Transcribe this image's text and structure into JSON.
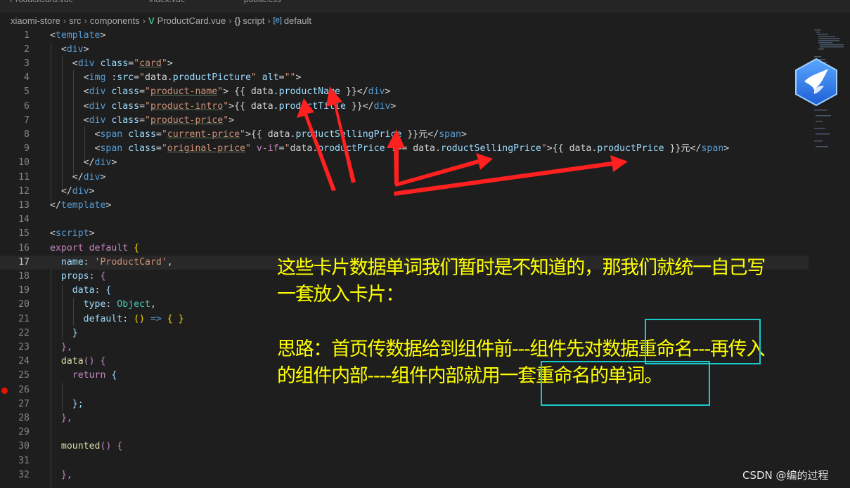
{
  "tabs": [
    "ProductCard.vue",
    "index.vue",
    "public.css"
  ],
  "breadcrumb": {
    "parts": [
      "xiaomi-store",
      "src",
      "components",
      "ProductCard.vue",
      "script",
      "default"
    ],
    "icon_vue": "V",
    "icon_braces": "{}",
    "icon_object": "[e]"
  },
  "active_line": 17,
  "breakpoint_line": 26,
  "code_lines": [
    {
      "n": "1",
      "tokens": [
        [
          "p",
          "<"
        ],
        [
          "t",
          "template"
        ],
        [
          "p",
          ">"
        ]
      ]
    },
    {
      "n": "2",
      "tokens": [
        [
          "p",
          "  <"
        ],
        [
          "t",
          "div"
        ],
        [
          "p",
          ">"
        ]
      ]
    },
    {
      "n": "3",
      "tokens": [
        [
          "p",
          "    <"
        ],
        [
          "t",
          "div"
        ],
        [
          "p",
          " "
        ],
        [
          "a",
          "class"
        ],
        [
          "p",
          "="
        ],
        [
          "s",
          "\""
        ],
        [
          "u",
          "card"
        ],
        [
          "s",
          "\""
        ],
        [
          "p",
          ">"
        ]
      ]
    },
    {
      "n": "4",
      "tokens": [
        [
          "p",
          "      <"
        ],
        [
          "t",
          "img"
        ],
        [
          "p",
          " :"
        ],
        [
          "a",
          "src"
        ],
        [
          "p",
          "="
        ],
        [
          "s",
          "\""
        ],
        [
          "n",
          "data."
        ],
        [
          "a",
          "productPicture"
        ],
        [
          "s",
          "\""
        ],
        [
          "p",
          " "
        ],
        [
          "a",
          "alt"
        ],
        [
          "p",
          "="
        ],
        [
          "s",
          "\"\""
        ],
        [
          "p",
          ">"
        ]
      ]
    },
    {
      "n": "5",
      "tokens": [
        [
          "p",
          "      <"
        ],
        [
          "t",
          "div"
        ],
        [
          "p",
          " "
        ],
        [
          "a",
          "class"
        ],
        [
          "p",
          "="
        ],
        [
          "s",
          "\""
        ],
        [
          "u",
          "product-name"
        ],
        [
          "s",
          "\""
        ],
        [
          "p",
          "> {{ "
        ],
        [
          "n",
          "data."
        ],
        [
          "a",
          "productName"
        ],
        [
          "p",
          " }}</"
        ],
        [
          "t",
          "div"
        ],
        [
          "p",
          ">"
        ]
      ]
    },
    {
      "n": "6",
      "tokens": [
        [
          "p",
          "      <"
        ],
        [
          "t",
          "div"
        ],
        [
          "p",
          " "
        ],
        [
          "a",
          "class"
        ],
        [
          "p",
          "="
        ],
        [
          "s",
          "\""
        ],
        [
          "u",
          "product-intro"
        ],
        [
          "s",
          "\""
        ],
        [
          "p",
          ">{{ "
        ],
        [
          "n",
          "data."
        ],
        [
          "a",
          "productTitle"
        ],
        [
          "p",
          " }}</"
        ],
        [
          "t",
          "div"
        ],
        [
          "p",
          ">"
        ]
      ]
    },
    {
      "n": "7",
      "tokens": [
        [
          "p",
          "      <"
        ],
        [
          "t",
          "div"
        ],
        [
          "p",
          " "
        ],
        [
          "a",
          "class"
        ],
        [
          "p",
          "="
        ],
        [
          "s",
          "\""
        ],
        [
          "u",
          "product-price"
        ],
        [
          "s",
          "\""
        ],
        [
          "p",
          ">"
        ]
      ]
    },
    {
      "n": "8",
      "tokens": [
        [
          "p",
          "        <"
        ],
        [
          "t",
          "span"
        ],
        [
          "p",
          " "
        ],
        [
          "a",
          "class"
        ],
        [
          "p",
          "="
        ],
        [
          "s",
          "\""
        ],
        [
          "u",
          "current-price"
        ],
        [
          "s",
          "\""
        ],
        [
          "p",
          ">{{ "
        ],
        [
          "n",
          "data."
        ],
        [
          "a",
          "productSellingPrice"
        ],
        [
          "p",
          " }}元</"
        ],
        [
          "t",
          "span"
        ],
        [
          "p",
          ">"
        ]
      ]
    },
    {
      "n": "9",
      "tokens": [
        [
          "p",
          "        <"
        ],
        [
          "t",
          "span"
        ],
        [
          "p",
          " "
        ],
        [
          "a",
          "class"
        ],
        [
          "p",
          "="
        ],
        [
          "s",
          "\""
        ],
        [
          "u",
          "original-price"
        ],
        [
          "s",
          "\""
        ],
        [
          "p",
          " "
        ],
        [
          "k",
          "v-if"
        ],
        [
          "p",
          "="
        ],
        [
          "s",
          "\""
        ],
        [
          "n",
          "data."
        ],
        [
          "a",
          "productPrice"
        ],
        [
          "p",
          " !== "
        ],
        [
          "n",
          "data."
        ],
        [
          "a",
          "roductSellingPrice"
        ],
        [
          "s",
          "\""
        ],
        [
          "p",
          ">{{ "
        ],
        [
          "n",
          "data."
        ],
        [
          "a",
          "productPrice"
        ],
        [
          "p",
          " }}元</"
        ],
        [
          "t",
          "span"
        ],
        [
          "p",
          ">"
        ]
      ]
    },
    {
      "n": "10",
      "tokens": [
        [
          "p",
          "      </"
        ],
        [
          "t",
          "div"
        ],
        [
          "p",
          ">"
        ]
      ]
    },
    {
      "n": "11",
      "tokens": [
        [
          "p",
          "    </"
        ],
        [
          "t",
          "div"
        ],
        [
          "p",
          ">"
        ]
      ]
    },
    {
      "n": "12",
      "tokens": [
        [
          "p",
          "  </"
        ],
        [
          "t",
          "div"
        ],
        [
          "p",
          ">"
        ]
      ]
    },
    {
      "n": "13",
      "tokens": [
        [
          "p",
          "</"
        ],
        [
          "t",
          "template"
        ],
        [
          "p",
          ">"
        ]
      ]
    },
    {
      "n": "14",
      "tokens": []
    },
    {
      "n": "15",
      "tokens": [
        [
          "p",
          "<"
        ],
        [
          "t",
          "script"
        ],
        [
          "p",
          ">"
        ]
      ]
    },
    {
      "n": "16",
      "tokens": [
        [
          "k",
          "export"
        ],
        [
          "p",
          " "
        ],
        [
          "k",
          "default"
        ],
        [
          "p",
          " "
        ],
        [
          "y",
          "{"
        ]
      ]
    },
    {
      "n": "17",
      "tokens": [
        [
          "p",
          "  "
        ],
        [
          "a",
          "name"
        ],
        [
          "p",
          ": "
        ],
        [
          "s",
          "'ProductCard'"
        ],
        [
          "p",
          ","
        ]
      ]
    },
    {
      "n": "18",
      "tokens": [
        [
          "p",
          "  "
        ],
        [
          "a",
          "props"
        ],
        [
          "p",
          ": "
        ],
        [
          "k",
          "{"
        ]
      ]
    },
    {
      "n": "19",
      "tokens": [
        [
          "p",
          "    "
        ],
        [
          "a",
          "data"
        ],
        [
          "p",
          ": "
        ],
        [
          "a",
          "{"
        ]
      ]
    },
    {
      "n": "20",
      "tokens": [
        [
          "p",
          "      "
        ],
        [
          "a",
          "type"
        ],
        [
          "p",
          ": "
        ],
        [
          "g",
          "Object"
        ],
        [
          "p",
          ","
        ]
      ]
    },
    {
      "n": "21",
      "tokens": [
        [
          "p",
          "      "
        ],
        [
          "a",
          "default"
        ],
        [
          "p",
          ": "
        ],
        [
          "y",
          "()"
        ],
        [
          "p",
          " "
        ],
        [
          "t",
          "=>"
        ],
        [
          "p",
          " "
        ],
        [
          "y",
          "{ }"
        ]
      ]
    },
    {
      "n": "22",
      "tokens": [
        [
          "p",
          "    "
        ],
        [
          "a",
          "}"
        ]
      ]
    },
    {
      "n": "23",
      "tokens": [
        [
          "p",
          "  "
        ],
        [
          "k",
          "},"
        ]
      ]
    },
    {
      "n": "24",
      "tokens": [
        [
          "p",
          "  "
        ],
        [
          "m",
          "data"
        ],
        [
          "k",
          "()"
        ],
        [
          "p",
          " "
        ],
        [
          "k",
          "{"
        ]
      ]
    },
    {
      "n": "25",
      "tokens": [
        [
          "p",
          "    "
        ],
        [
          "k",
          "return"
        ],
        [
          "p",
          " "
        ],
        [
          "a",
          "{"
        ]
      ]
    },
    {
      "n": "26",
      "tokens": []
    },
    {
      "n": "27",
      "tokens": [
        [
          "p",
          "    "
        ],
        [
          "a",
          "};"
        ]
      ]
    },
    {
      "n": "28",
      "tokens": [
        [
          "p",
          "  "
        ],
        [
          "k",
          "},"
        ]
      ]
    },
    {
      "n": "29",
      "tokens": []
    },
    {
      "n": "30",
      "tokens": [
        [
          "p",
          "  "
        ],
        [
          "m",
          "mounted"
        ],
        [
          "k",
          "()"
        ],
        [
          "p",
          " "
        ],
        [
          "k",
          "{"
        ]
      ]
    },
    {
      "n": "31",
      "tokens": []
    },
    {
      "n": "32",
      "tokens": [
        [
          "p",
          "  "
        ],
        [
          "k",
          "},"
        ]
      ]
    }
  ],
  "annotation": {
    "line1": "这些卡片数据单词我们暂时是不知道的，那我们就统一自己写",
    "line2": "一套放入卡片：",
    "line3": "思路：首页传数据给到组件前---组件先对数据重命名---再传入",
    "line4": "的组件内部----组件内部就用一套重命名的单词。"
  },
  "colors": {
    "annotation": "#ffff00",
    "arrow": "#ff2020",
    "box": "#17c9c9"
  },
  "watermark": "CSDN @编的过程",
  "logo_icon": "bird-logo-icon"
}
